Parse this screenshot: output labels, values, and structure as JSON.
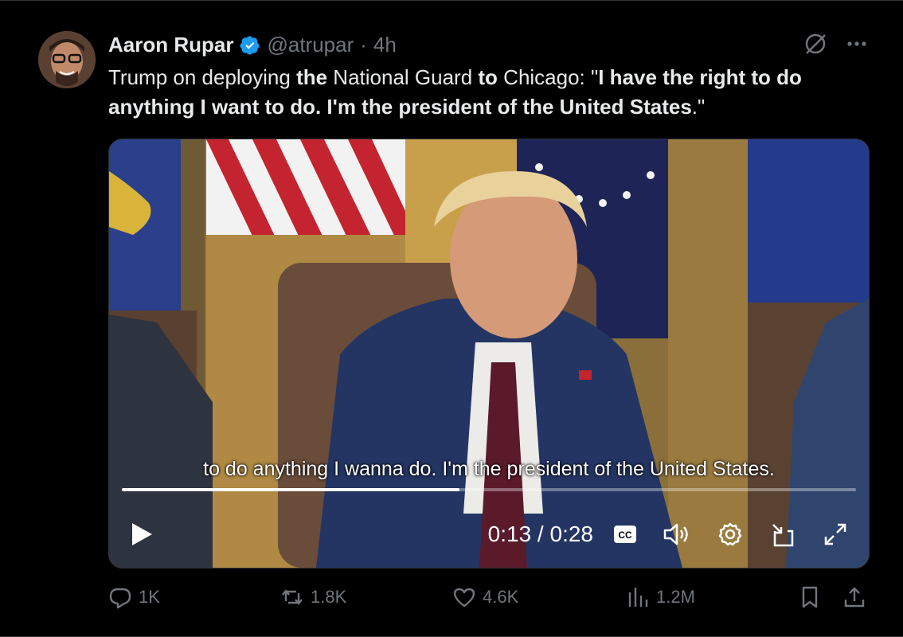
{
  "author": {
    "name": "Aaron Rupar",
    "handle": "@atrupar",
    "separator": "·",
    "time": "4h"
  },
  "tweet": {
    "segments": [
      {
        "text": "Trump on deploying ",
        "bold": false
      },
      {
        "text": "the",
        "bold": true
      },
      {
        "text": " National Guard ",
        "bold": false
      },
      {
        "text": "to",
        "bold": true
      },
      {
        "text": " Chicago: \"",
        "bold": false
      },
      {
        "text": "I have the right to do anything I want to do. I'm the president of the United States",
        "bold": true
      },
      {
        "text": ".\"",
        "bold": false
      }
    ]
  },
  "video": {
    "caption": "to do anything I wanna do. I'm the president of the United States.",
    "time_display": "0:13 / 0:28",
    "progress": 0.46
  },
  "actions": {
    "replies": "1K",
    "reposts": "1.8K",
    "likes": "4.6K",
    "views": "1.2M"
  },
  "colors": {
    "verified": "#1d9bf0",
    "muted": "#71767b"
  }
}
